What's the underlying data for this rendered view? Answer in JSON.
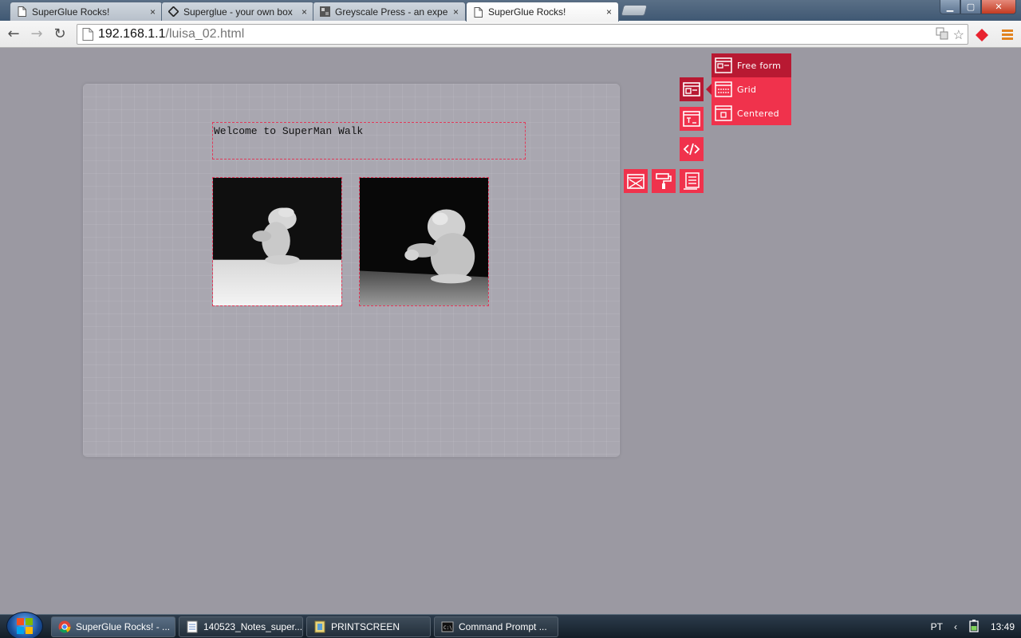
{
  "browser": {
    "tabs": [
      {
        "title": "SuperGlue Rocks!",
        "icon": "page-icon"
      },
      {
        "title": "Superglue - your own box",
        "icon": "superglue-diamond-icon"
      },
      {
        "title": "Greyscale Press - an experi",
        "icon": "greyscale-icon"
      },
      {
        "title": "SuperGlue Rocks!",
        "icon": "page-icon"
      }
    ],
    "close_glyph": "×",
    "window_buttons": {
      "minimize": "▁",
      "maximize": "▢",
      "close": "✕"
    },
    "nav": {
      "back": "←",
      "forward": "→",
      "reload": "↻"
    },
    "url": {
      "host": "192.168.1.1",
      "path": "/luisa_02.html"
    }
  },
  "page": {
    "welcome_text": "Welcome to SuperMan Walk",
    "images": [
      {
        "alt": "clay figure sitting"
      },
      {
        "alt": "clay figure reaching"
      }
    ]
  },
  "toolbar_panel": {
    "tools": [
      "layout-icon",
      "text-block-icon",
      "code-icon",
      "image-placeholder-icon",
      "paint-roller-icon",
      "list-icon"
    ],
    "layout_menu": [
      {
        "label": "Free form",
        "selected": true
      },
      {
        "label": "Grid",
        "selected": false
      },
      {
        "label": "Centered",
        "selected": false
      }
    ],
    "accent_color": "#f0324c",
    "accent_dark": "#b81932"
  },
  "taskbar": {
    "items": [
      {
        "label": "SuperGlue Rocks! - ...",
        "icon": "chrome-icon",
        "active": true
      },
      {
        "label": "140523_Notes_super...",
        "icon": "notepad-icon",
        "active": false
      },
      {
        "label": "PRINTSCREEN",
        "icon": "paint-icon",
        "active": false
      },
      {
        "label": "Command Prompt ...",
        "icon": "cmd-icon",
        "active": false
      }
    ],
    "language": "PT",
    "time": "13:49"
  }
}
